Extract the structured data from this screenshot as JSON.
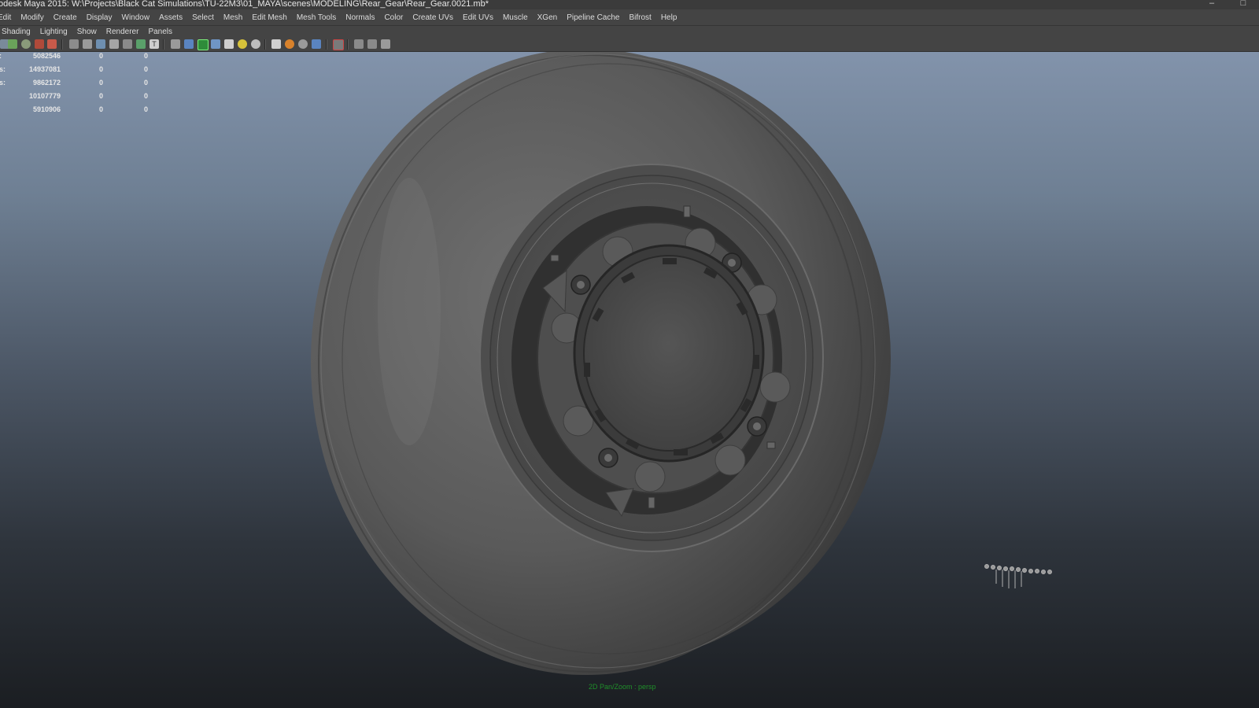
{
  "title": "odesk Maya 2015: W:\\Projects\\Black Cat Simulations\\TU-22M3\\01_MAYA\\scenes\\MODELING\\Rear_Gear\\Rear_Gear.0021.mb*",
  "window_buttons": {
    "minimize": "–",
    "restore": "□"
  },
  "menu": [
    "Edit",
    "Modify",
    "Create",
    "Display",
    "Window",
    "Assets",
    "Select",
    "Mesh",
    "Edit Mesh",
    "Mesh Tools",
    "Normals",
    "Color",
    "Create UVs",
    "Edit UVs",
    "Muscle",
    "XGen",
    "Pipeline Cache",
    "Bifrost",
    "Help"
  ],
  "panel_menu": [
    "Shading",
    "Lighting",
    "Show",
    "Renderer",
    "Panels"
  ],
  "hud_rows": [
    {
      "label": ":",
      "value": "5082546",
      "selected": "0",
      "components": "0"
    },
    {
      "label": "s:",
      "value": "14937081",
      "selected": "0",
      "components": "0"
    },
    {
      "label": "s:",
      "value": "9862172",
      "selected": "0",
      "components": "0"
    },
    {
      "label": "",
      "value": "10107779",
      "selected": "0",
      "components": "0"
    },
    {
      "label": "",
      "value": "5910906",
      "selected": "0",
      "components": "0"
    }
  ],
  "camera_label": "2D Pan/Zoom : persp",
  "colors": {
    "menu_bg": "#444444",
    "viewport_top": "#8293ab",
    "viewport_bottom": "#1b1e22",
    "camera_label": "#1f8f2a",
    "model_grey": "#5a5a5a"
  },
  "toolbar_icons": [
    "grid-icon",
    "film-icon",
    "camera-icon",
    "camera-key-icon",
    "wireframe-icon",
    "smooth-shade-icon",
    "textured-icon",
    "lights-icon",
    "shadows-icon",
    "isolate-icon",
    "xray-icon",
    "xray-joints-icon",
    "backface-icon",
    "resolution-gate-icon",
    "film-gate-icon",
    "field-chart-icon",
    "safe-action-icon",
    "grease-pencil-icon",
    "ssao-icon",
    "motion-blur-icon",
    "multisample-icon",
    "depth-of-field-icon",
    "select-camera-icon",
    "perspective-icon",
    "ortho-icon",
    "node-icon"
  ]
}
